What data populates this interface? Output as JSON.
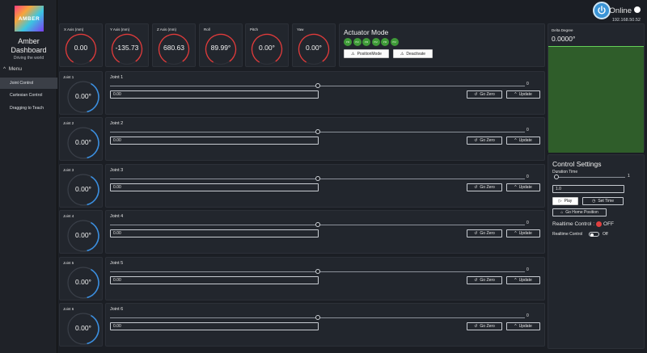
{
  "header": {
    "status": "Online",
    "ip": "192.168.50.52"
  },
  "sidebar": {
    "logo_text": "AMBER",
    "title": "Amber Dashboard",
    "subtitle": "Driving the world",
    "menu_label": "Menu",
    "items": [
      {
        "label": "Joint Control",
        "active": true
      },
      {
        "label": "Cartesian Control",
        "active": false
      },
      {
        "label": "Dragging to Teach",
        "active": false
      }
    ]
  },
  "axes": [
    {
      "label": "X Axis (mm)",
      "value": "0.00",
      "color": "#e23b3b"
    },
    {
      "label": "Y Axis (mm)",
      "value": "-135.73",
      "color": "#e23b3b"
    },
    {
      "label": "Z Axis (mm)",
      "value": "680.63",
      "color": "#e23b3b"
    },
    {
      "label": "Roll",
      "value": "89.99°",
      "color": "#e23b3b"
    },
    {
      "label": "Pitch",
      "value": "0.00°",
      "color": "#e23b3b"
    },
    {
      "label": "Yaw",
      "value": "0.00°",
      "color": "#e23b3b"
    }
  ],
  "actuator": {
    "title": "Actuator Mode",
    "leds": [
      "PM",
      "PM",
      "PM",
      "PM",
      "PM",
      "PM"
    ],
    "position_mode_label": "PositionMode",
    "deactivate_label": "Deactivate"
  },
  "delta": {
    "title": "Delta Degree",
    "value": "0.0000°"
  },
  "joints": [
    {
      "gauge_label": "Joint 1",
      "value": "0.00°",
      "title": "Joint 1",
      "slider_value": "0",
      "input_value": "0.00"
    },
    {
      "gauge_label": "Joint 2",
      "value": "0.00°",
      "title": "Joint 2",
      "slider_value": "0",
      "input_value": "0.00"
    },
    {
      "gauge_label": "Joint 3",
      "value": "0.00°",
      "title": "Joint 3",
      "slider_value": "0",
      "input_value": "0.00"
    },
    {
      "gauge_label": "Joint 4",
      "value": "0.00°",
      "title": "Joint 4",
      "slider_value": "0",
      "input_value": "0.00"
    },
    {
      "gauge_label": "Joint 5",
      "value": "0.00°",
      "title": "Joint 5",
      "slider_value": "0",
      "input_value": "0.00"
    },
    {
      "gauge_label": "Joint 6",
      "value": "0.00°",
      "title": "Joint 6",
      "slider_value": "0",
      "input_value": "0.00"
    }
  ],
  "joint_buttons": {
    "go_zero": "Go Zero",
    "update": "Update"
  },
  "control_settings": {
    "title": "Control Settings",
    "duration_label": "Duration Time",
    "duration_slider_value": "1",
    "duration_input": "1.0",
    "play_label": "Play",
    "set_time_label": "Set Time",
    "go_home_label": "Go Home Position",
    "realtime_status_label": "Realtime Control :",
    "realtime_status_value": "OFF",
    "realtime_toggle_label": "Realtime Control",
    "realtime_toggle_value": "Off"
  },
  "colors": {
    "joint_gauge": "#3b8fe0",
    "axis_gauge": "#e23b3b",
    "led": "#3f9a38",
    "delta_plot": "#2f5d2a"
  }
}
